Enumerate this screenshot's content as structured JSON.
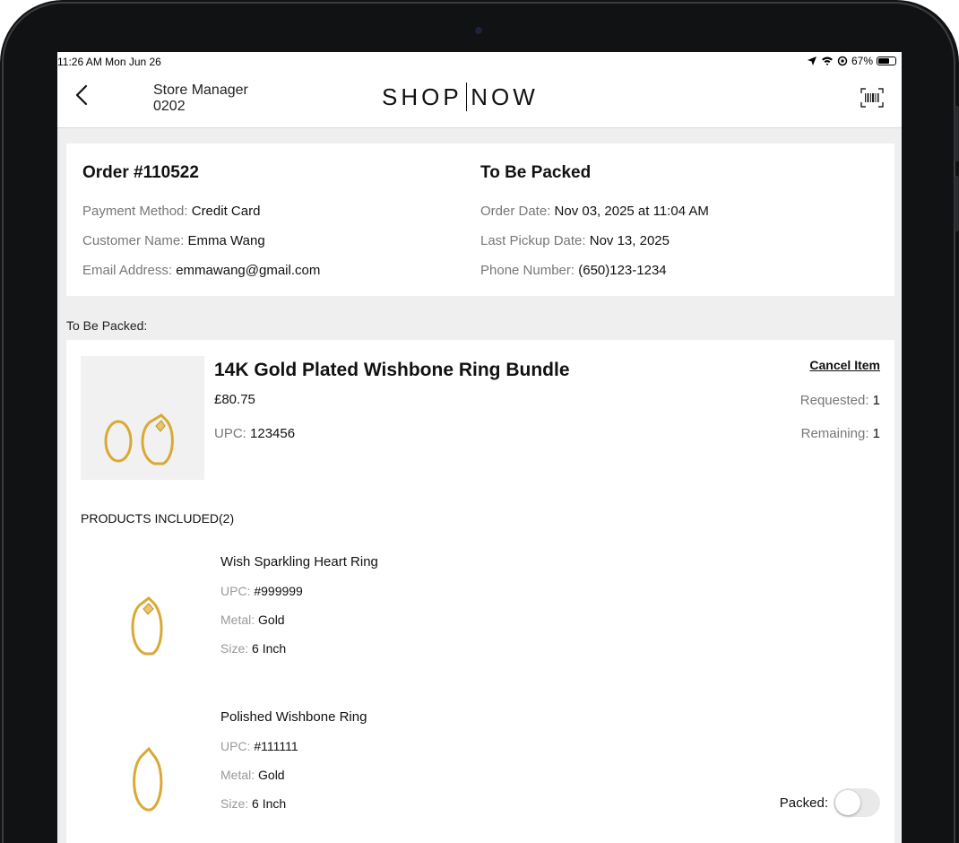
{
  "status": {
    "time": "11:26 AM  Mon Jun 26",
    "battery": "67%",
    "battery_level": 0.67
  },
  "nav": {
    "manager_line1": "Store Manager",
    "manager_line2": "0202",
    "logo_left": "SHOP",
    "logo_right": "NOW"
  },
  "order": {
    "title": "Order #110522",
    "status": "To Be Packed",
    "payment_label": "Payment Method: ",
    "payment": "Credit Card",
    "customer_label": "Customer Name: ",
    "customer": "Emma Wang",
    "email_label": "Email Address: ",
    "email": "emmawang@gmail.com",
    "order_date_label": "Order Date: ",
    "order_date": "Nov 03, 2025 at 11:04 AM",
    "pickup_label": "Last Pickup Date: ",
    "pickup": "Nov 13, 2025",
    "phone_label": "Phone Number: ",
    "phone": "(650)123-1234"
  },
  "section_label": "To Be Packed:",
  "item": {
    "title": "14K Gold Plated Wishbone Ring Bundle",
    "price": "£80.75",
    "upc_label": "UPC: ",
    "upc": "123456",
    "cancel": "Cancel Item",
    "requested_label": "Requested: ",
    "requested": "1",
    "remaining_label": "Remaining: ",
    "remaining": "1",
    "products_label": "PRODUCTS INCLUDED(2)",
    "products": [
      {
        "name": "Wish Sparkling Heart Ring",
        "upc_label": "UPC: ",
        "upc": "#999999",
        "metal_label": "Metal: ",
        "metal": "Gold",
        "size_label": "Size: ",
        "size": "6 Inch"
      },
      {
        "name": "Polished Wishbone Ring",
        "upc_label": "UPC: ",
        "upc": "#111111",
        "metal_label": "Metal: ",
        "metal": "Gold",
        "size_label": "Size: ",
        "size": "6 Inch"
      }
    ],
    "packed_label": "Packed:"
  },
  "colors": {
    "gold": "#d9a934",
    "bezel": "#111214"
  }
}
